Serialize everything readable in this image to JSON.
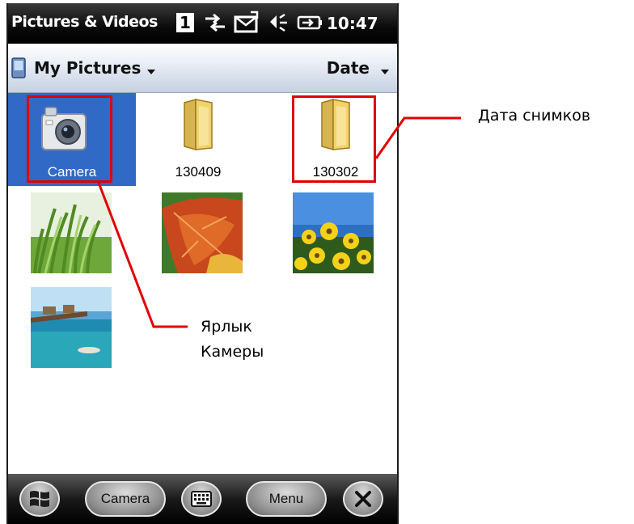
{
  "statusbar": {
    "app_title": "Pictures & Videos",
    "signal_box": "1",
    "time": "10:47",
    "icons": [
      "connectivity-icon",
      "message-icon",
      "speaker-icon",
      "battery-icon"
    ]
  },
  "toolbar": {
    "folder_label": "My Pictures",
    "sort_label": "Date"
  },
  "grid": {
    "items": [
      {
        "label": "Camera",
        "kind": "camera-shortcut",
        "selected": true
      },
      {
        "label": "130409",
        "kind": "folder"
      },
      {
        "label": "130302",
        "kind": "folder"
      },
      {
        "kind": "photo",
        "subject": "grass"
      },
      {
        "kind": "photo",
        "subject": "autumn-leaf"
      },
      {
        "kind": "photo",
        "subject": "yellow-flowers"
      },
      {
        "kind": "photo",
        "subject": "tropical-pier"
      }
    ]
  },
  "taskbar": {
    "start_icon": "windows-logo-icon",
    "camera_label": "Camera",
    "keyboard_icon": "keyboard-icon",
    "menu_label": "Menu",
    "close_icon": "close-icon"
  },
  "annotations": {
    "date_callout": "Дата снимков",
    "camera_callout_line1": "Ярлык",
    "camera_callout_line2": "Камеры",
    "highlight_color": "#e00000"
  },
  "colors": {
    "selection": "#3169c6",
    "folder_yellow": "#f2d36b"
  }
}
